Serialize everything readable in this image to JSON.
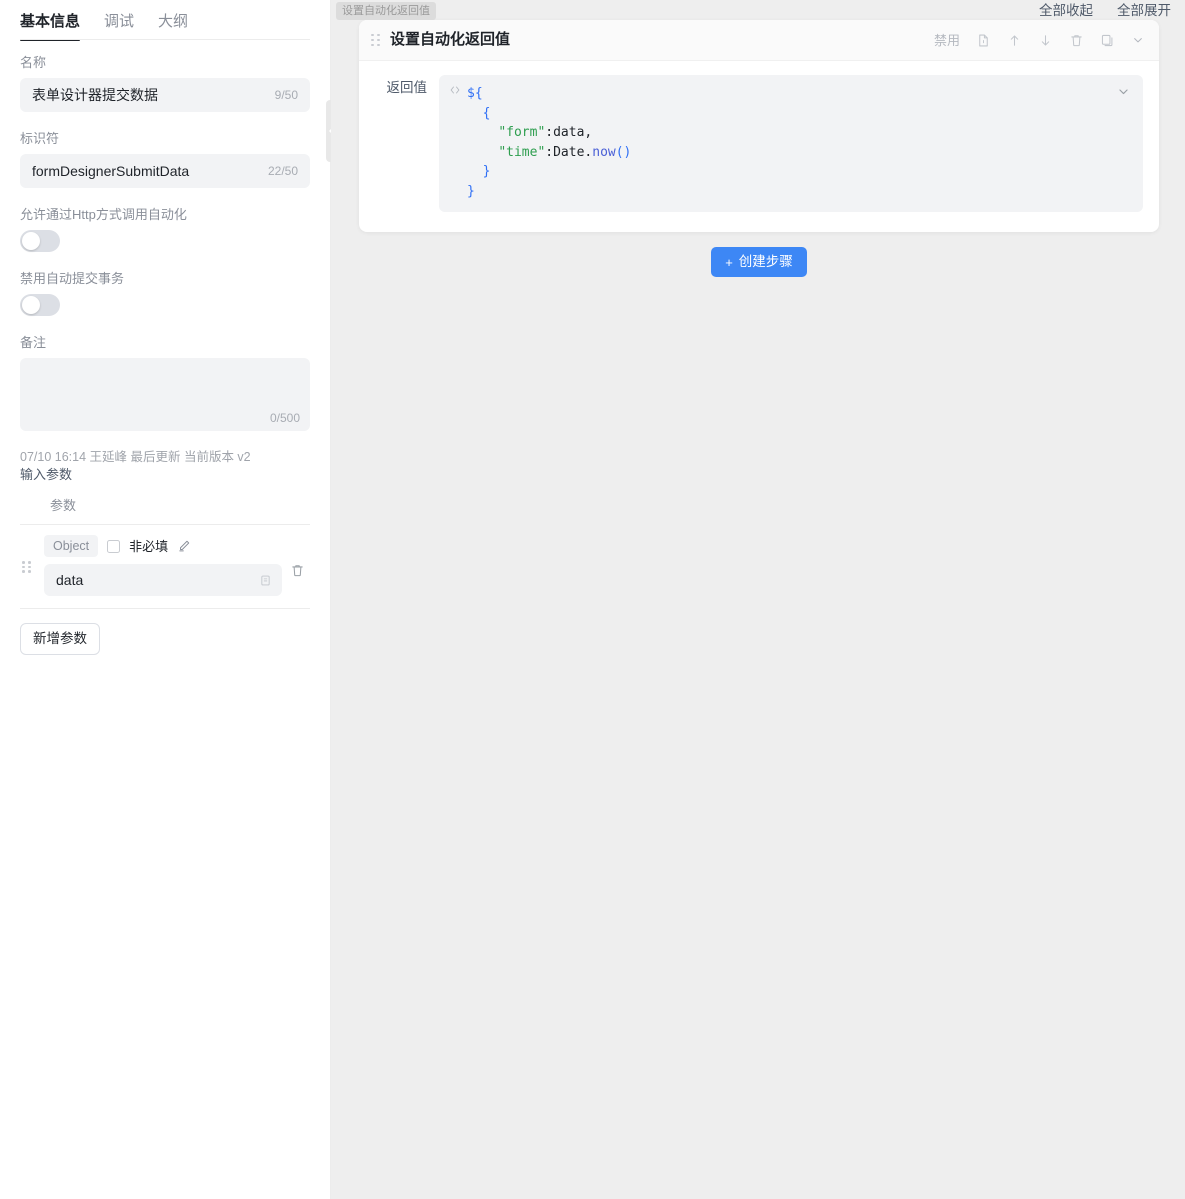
{
  "sidebar": {
    "tabs": [
      {
        "label": "基本信息",
        "active": true
      },
      {
        "label": "调试",
        "active": false
      },
      {
        "label": "大纲",
        "active": false
      }
    ],
    "name_field": {
      "label": "名称",
      "value": "表单设计器提交数据",
      "counter": "9/50"
    },
    "identifier_field": {
      "label": "标识符",
      "value": "formDesignerSubmitData",
      "counter": "22/50"
    },
    "http_toggle": {
      "label": "允许通过Http方式调用自动化",
      "state": "off"
    },
    "transaction_toggle": {
      "label": "禁用自动提交事务",
      "state": "off"
    },
    "remark_field": {
      "label": "备注",
      "value": "",
      "counter": "0/500"
    },
    "meta": "07/10 16:14 王延峰 最后更新 当前版本 v2",
    "input_params_title": "输入参数",
    "param_column_header": "参数",
    "param_rows": [
      {
        "type_tag": "Object",
        "required_label": "非必填",
        "checked": false,
        "name": "data"
      }
    ],
    "add_param_button": "新增参数"
  },
  "canvas": {
    "float_chip": "设置自动化返回值",
    "top_actions": [
      {
        "label": "全部收起"
      },
      {
        "label": "全部展开"
      }
    ],
    "step_card": {
      "title": "设置自动化返回值",
      "disable_label": "禁用",
      "icons": [
        "document-icon",
        "move-up-icon",
        "move-down-icon",
        "delete-icon",
        "duplicate-icon",
        "chevron-down-icon"
      ],
      "return_label": "返回值",
      "code_lines": [
        [
          {
            "t": "${",
            "c": "brace"
          }
        ],
        [
          {
            "t": "  ",
            "c": "punc"
          },
          {
            "t": "{",
            "c": "brace"
          }
        ],
        [
          {
            "t": "    ",
            "c": "punc"
          },
          {
            "t": "\"form\"",
            "c": "str"
          },
          {
            "t": ":",
            "c": "punc"
          },
          {
            "t": "data",
            "c": "ident"
          },
          {
            "t": ",",
            "c": "punc"
          }
        ],
        [
          {
            "t": "    ",
            "c": "punc"
          },
          {
            "t": "\"time\"",
            "c": "str"
          },
          {
            "t": ":",
            "c": "punc"
          },
          {
            "t": "Date",
            "c": "ident"
          },
          {
            "t": ".",
            "c": "punc"
          },
          {
            "t": "now",
            "c": "fn"
          },
          {
            "t": "()",
            "c": "brace"
          }
        ],
        [
          {
            "t": "  ",
            "c": "punc"
          },
          {
            "t": "}",
            "c": "brace"
          }
        ],
        [
          {
            "t": "}",
            "c": "brace"
          }
        ]
      ]
    },
    "add_step_button": "创建步骤",
    "add_step_plus": "+"
  },
  "colors": {
    "accent": "#3d87f5",
    "code_brace": "#2f6ff5",
    "code_string": "#2e9e4f",
    "code_fn": "#4a5fd6",
    "canvas_bg": "#eeeeee",
    "field_bg": "#f2f3f5"
  }
}
